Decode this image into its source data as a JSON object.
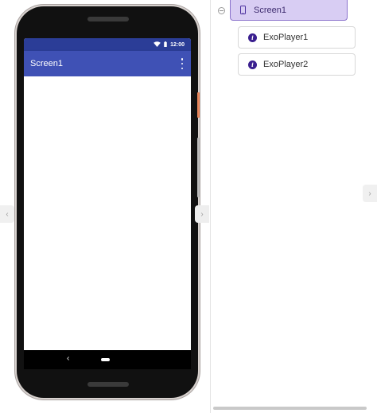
{
  "viewer": {
    "status_bar": {
      "time": "12:00",
      "wifi_icon": "wifi-icon",
      "battery_icon": "battery-icon"
    },
    "title_bar": {
      "title": "Screen1",
      "menu_icon": "overflow-menu-icon"
    },
    "nav_bar": {
      "back_glyph": "‹",
      "home_icon": "home-pill-icon"
    },
    "arrows": {
      "left": "‹",
      "middle": "›",
      "right": "›"
    }
  },
  "tree": {
    "root": {
      "label": "Screen1",
      "icon": "phone-icon",
      "expanded": true
    },
    "children": [
      {
        "label": "ExoPlayer1",
        "icon": "exoplayer-icon"
      },
      {
        "label": "ExoPlayer2",
        "icon": "exoplayer-icon"
      }
    ]
  },
  "colors": {
    "status_bar": "#2b3d97",
    "title_bar": "#3f51b5",
    "selected_node": "#d8cdf3",
    "selected_border": "#8a72cc",
    "icon_accent": "#3a1f8f"
  }
}
